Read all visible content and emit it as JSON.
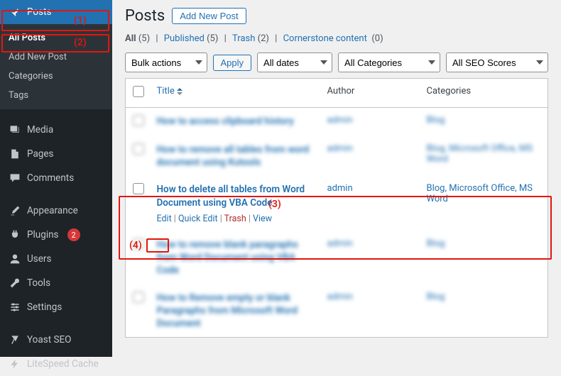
{
  "sidebar": {
    "items": [
      {
        "label": "Posts"
      },
      {
        "label": "Media"
      },
      {
        "label": "Pages"
      },
      {
        "label": "Comments"
      },
      {
        "label": "Appearance"
      },
      {
        "label": "Plugins",
        "badge": "2"
      },
      {
        "label": "Users"
      },
      {
        "label": "Tools"
      },
      {
        "label": "Settings"
      },
      {
        "label": "Yoast SEO"
      },
      {
        "label": "LiteSpeed Cache"
      }
    ],
    "submenu": [
      {
        "label": "All Posts"
      },
      {
        "label": "Add New Post"
      },
      {
        "label": "Categories"
      },
      {
        "label": "Tags"
      }
    ]
  },
  "header": {
    "title": "Posts",
    "add_btn": "Add New Post"
  },
  "statuses": {
    "all": "All",
    "all_count": "(5)",
    "published": "Published",
    "published_count": "(5)",
    "trash": "Trash",
    "trash_count": "(2)",
    "cornerstone": "Cornerstone content",
    "cornerstone_count": "(0)"
  },
  "toolbar": {
    "bulk": "Bulk actions",
    "apply": "Apply",
    "dates": "All dates",
    "categories": "All Categories",
    "seo": "All SEO Scores"
  },
  "columns": {
    "title": "Title",
    "author": "Author",
    "categories": "Categories"
  },
  "rows": [
    {
      "title": "How to access clipboard history",
      "author": "admin",
      "categories": "Blog",
      "blur": true
    },
    {
      "title": "How to remove all tables from word document using Kutools",
      "author": "admin",
      "categories": "Blog, Microsoft Office, MS Word",
      "blur": true
    },
    {
      "title": "How to delete all tables from Word Document using VBA Code",
      "author": "admin",
      "categories": "Blog, Microsoft Office, MS Word",
      "blur": false,
      "actions": {
        "edit": "Edit",
        "quick_edit": "Quick Edit",
        "trash": "Trash",
        "view": "View"
      }
    },
    {
      "title": "How to remove blank paragraphs from Word Document using VBA Code",
      "author": "admin",
      "categories": "Blog",
      "blur": true
    },
    {
      "title": "How to Remove empty or blank Paragraphs from Microsoft Word Document",
      "author": "admin",
      "categories": "Blog",
      "blur": true
    }
  ],
  "callouts": {
    "c1": "(1)",
    "c2": "(2)",
    "c3": "(3)",
    "c4": "(4)"
  }
}
